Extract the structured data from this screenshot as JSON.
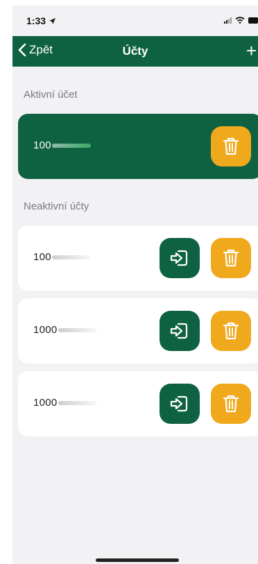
{
  "status": {
    "time": "1:33"
  },
  "nav": {
    "back_label": "Zpět",
    "title": "Účty",
    "add_label": "+"
  },
  "active_section": {
    "label": "Aktivní účet",
    "account": {
      "number": "100",
      "obscured": true
    }
  },
  "inactive_section": {
    "label": "Neaktivní účty",
    "accounts": [
      {
        "number": "100"
      },
      {
        "number": "1000"
      },
      {
        "number": "1000"
      }
    ]
  },
  "colors": {
    "brand_green": "#0e6242",
    "delete_orange": "#f0a81c",
    "background": "#f2f2f4"
  },
  "icons": {
    "back": "chevron-left-icon",
    "add": "plus-icon",
    "delete": "trash-icon",
    "login": "login-icon"
  }
}
